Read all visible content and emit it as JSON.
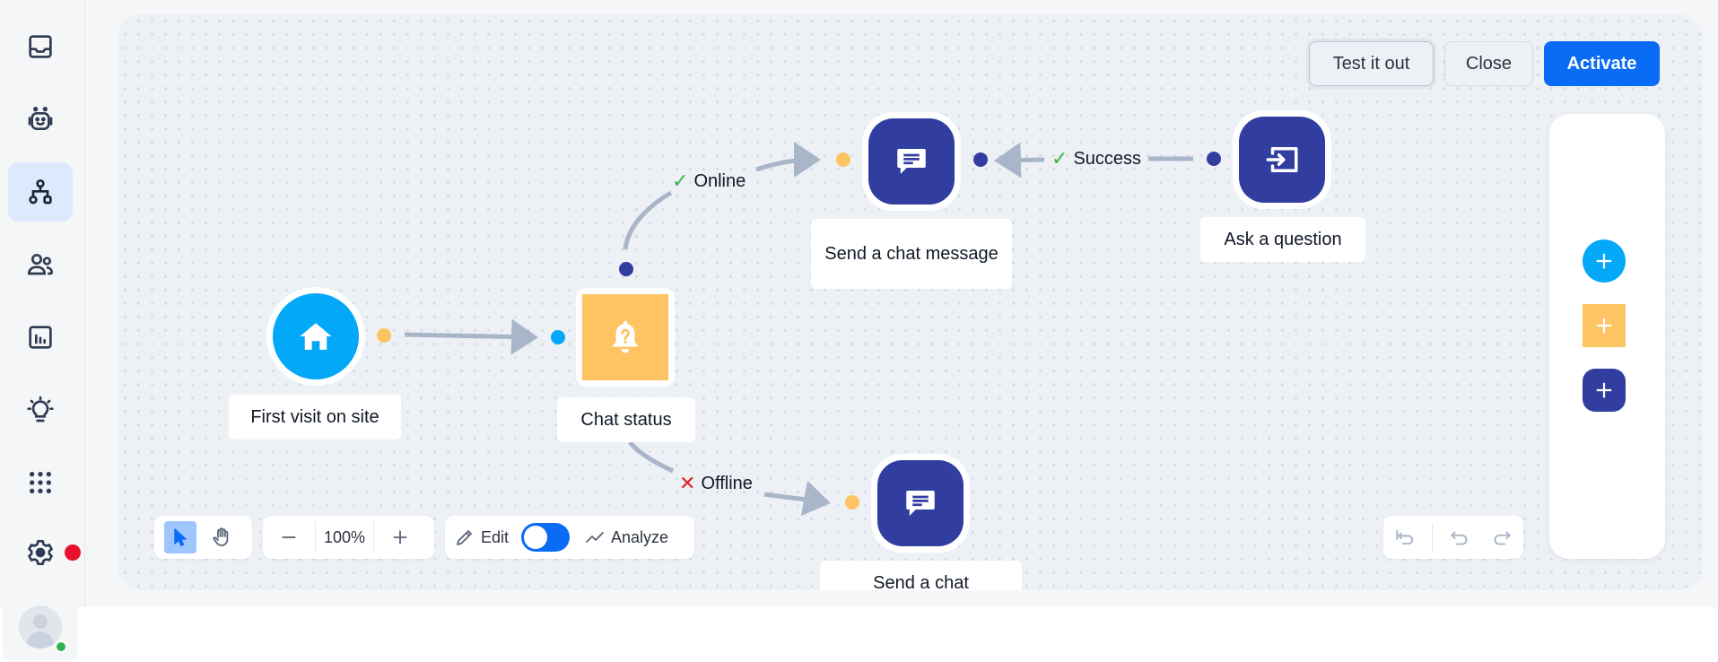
{
  "sidebar": {
    "items": [
      {
        "id": "inbox",
        "icon": "inbox-icon",
        "active": false
      },
      {
        "id": "chatbots",
        "icon": "bot-icon",
        "active": false
      },
      {
        "id": "flows",
        "icon": "flow-icon",
        "active": true
      },
      {
        "id": "customers",
        "icon": "users-icon",
        "active": false
      },
      {
        "id": "analytics",
        "icon": "bar-chart-icon",
        "active": false
      },
      {
        "id": "ideas",
        "icon": "lightbulb-icon",
        "active": false
      },
      {
        "id": "apps",
        "icon": "grid-icon",
        "active": false
      },
      {
        "id": "settings",
        "icon": "gear-icon",
        "active": false,
        "notification": true
      }
    ],
    "user": {
      "status": "online",
      "status_color": "#2fb552"
    }
  },
  "header_actions": {
    "test_label": "Test it out",
    "close_label": "Close",
    "activate_label": "Activate"
  },
  "colors": {
    "accent": "#0a6cf5",
    "trigger": "#04a8f8",
    "condition": "#fec362",
    "action": "#313ea0",
    "edge": "#a9b5c9",
    "success": "#3cb44b",
    "failure": "#e02424",
    "notification": "#e8112d"
  },
  "palette": {
    "items": [
      {
        "type": "trigger",
        "icon": "plus-icon"
      },
      {
        "type": "condition",
        "icon": "plus-icon"
      },
      {
        "type": "action",
        "icon": "plus-icon"
      }
    ]
  },
  "flow": {
    "nodes": [
      {
        "id": "n1",
        "type": "trigger",
        "icon": "home-icon",
        "label": "First visit on site"
      },
      {
        "id": "n2",
        "type": "condition",
        "icon": "bell-question-icon",
        "label": "Chat status"
      },
      {
        "id": "n3",
        "type": "action",
        "icon": "chat-message-icon",
        "label": "Send a chat message"
      },
      {
        "id": "n4",
        "type": "action",
        "icon": "ask-question-icon",
        "label": "Ask a question"
      },
      {
        "id": "n5",
        "type": "action",
        "icon": "chat-message-icon",
        "label": "Send a chat"
      }
    ],
    "edges": [
      {
        "from": "n1",
        "to": "n2",
        "label": ""
      },
      {
        "from": "n2",
        "to": "n3",
        "label": "Online",
        "mark": "✓"
      },
      {
        "from": "n2",
        "to": "n5",
        "label": "Offline",
        "mark": "✕"
      },
      {
        "from": "n4",
        "to": "n3",
        "label": "Success",
        "mark": "✓"
      }
    ]
  },
  "toolbar": {
    "mode": {
      "selected": "select"
    },
    "zoom_level": "100%",
    "edit_label": "Edit",
    "analyze_label": "Analyze",
    "toggle_state": "edit"
  }
}
